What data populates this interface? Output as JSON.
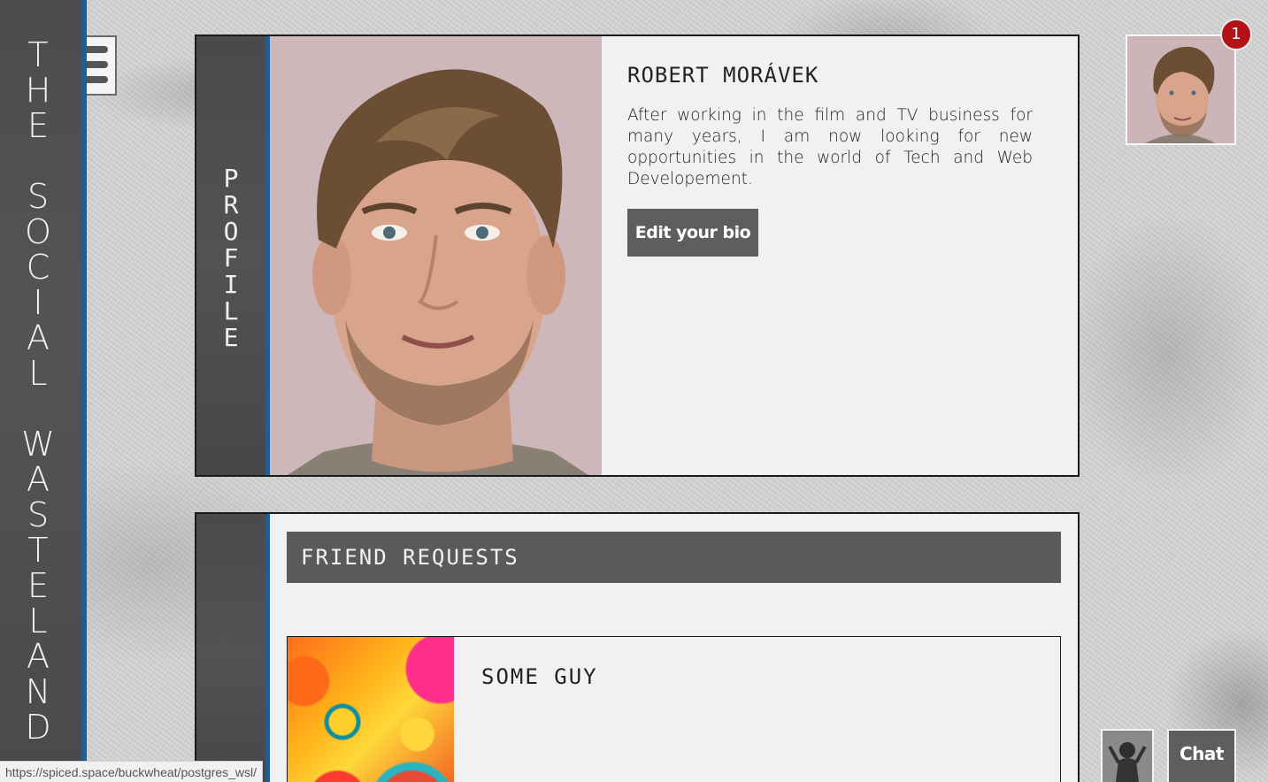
{
  "site": {
    "title_lines": [
      "T",
      "H",
      "E",
      "",
      "S",
      "O",
      "C",
      "I",
      "A",
      "L",
      "",
      "W",
      "A",
      "S",
      "T",
      "E",
      "L",
      "A",
      "N",
      "D"
    ]
  },
  "profile": {
    "section_label": [
      "P",
      "R",
      "O",
      "F",
      "I",
      "L",
      "E"
    ],
    "name": "ROBERT MORÁVEK",
    "bio": "After working in the film and TV business for many years, I am now looking for new opportunities in the world of Tech and Web Developement.",
    "edit_bio_label": "Edit your bio"
  },
  "friend_requests": {
    "title": "FRIEND REQUESTS",
    "items": [
      {
        "name": "SOME GUY"
      }
    ]
  },
  "header": {
    "notification_count": "1"
  },
  "chat": {
    "label": "Chat"
  },
  "status_bar": {
    "url": "https://spiced.space/buckwheat/postgres_wsl/"
  },
  "colors": {
    "accent_blue": "#1d5f94",
    "panel_dark": "#4d4d4d",
    "button_gray": "#5e5e5e",
    "badge_red": "#b31217",
    "card_bg": "#f1f1f1"
  }
}
